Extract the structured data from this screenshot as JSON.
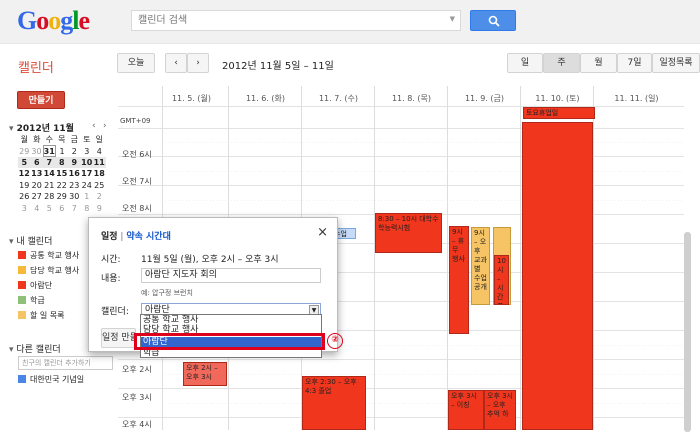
{
  "header": {
    "logo": "Google",
    "search_placeholder": "캘린더 검색"
  },
  "toolbar": {
    "app_title": "캘린더",
    "today": "오늘",
    "prev": "‹",
    "next": "›",
    "date_range": "2012년 11월 5일 – 11일",
    "views": {
      "day": "일",
      "week": "주",
      "month": "월",
      "seven_day": "7일",
      "schedule": "일정목록"
    }
  },
  "sidebar": {
    "create": "만들기",
    "mini_calendar": {
      "title": "2012년 11월",
      "weekdays": [
        "월",
        "화",
        "수",
        "목",
        "금",
        "토",
        "일"
      ],
      "rows": [
        [
          "29",
          "30",
          "31",
          "1",
          "2",
          "3",
          "4"
        ],
        [
          "5",
          "6",
          "7",
          "8",
          "9",
          "10",
          "11"
        ],
        [
          "12",
          "13",
          "14",
          "15",
          "16",
          "17",
          "18"
        ],
        [
          "19",
          "20",
          "21",
          "22",
          "23",
          "24",
          "25"
        ],
        [
          "26",
          "27",
          "28",
          "29",
          "30",
          "1",
          "2"
        ],
        [
          "3",
          "4",
          "5",
          "6",
          "7",
          "8",
          "9"
        ]
      ]
    },
    "my_calendars_title": "내 캘린더",
    "my_calendars": [
      {
        "label": "공통 학교 행사",
        "color": "#f1361e"
      },
      {
        "label": "담당 학교 행사",
        "color": "#f6b93b"
      },
      {
        "label": "아람단",
        "color": "#f1361e"
      },
      {
        "label": "학급",
        "color": "#8ec07a"
      },
      {
        "label": "할 일 목록",
        "color": "#f6c365"
      }
    ],
    "other_calendars_title": "다른 캘린더",
    "friend_input_placeholder": "친구의 캘린더 추가하기",
    "other_calendars": [
      {
        "label": "대한민국 기념일",
        "color": "#4a86e8"
      }
    ]
  },
  "grid": {
    "timezone": "GMT+09",
    "days": [
      "11. 5. (월)",
      "11. 6. (화)",
      "11. 7. (수)",
      "11. 8. (목)",
      "11. 9. (금)",
      "11. 10. (토)",
      "11. 11. (일)"
    ],
    "times": [
      "오전 6시",
      "오전 7시",
      "오전 8시",
      "오후 2시",
      "오후 3시",
      "오후 4시"
    ],
    "events": {
      "allday_sat": "토요휴업일",
      "wed_morning": "수업",
      "thu_morning": "8:30 – 10시 대학수학능력시험",
      "fri_a": "9시 – 휴무 행사",
      "fri_b": "9시 – 오후 교과별 수업공개",
      "fri_c": "10시 – 시간표 운영",
      "mon_pm": "오후 2시 – 오후 3시",
      "wed_pm": "오후 2:30 – 오후 4:3 졸업",
      "fri_pm_a": "오후 3시 – 이칭",
      "fri_pm_b": "오후 3시 – 오후 추억 하"
    }
  },
  "popup": {
    "title_prefix": "일정",
    "title_sep": " | ",
    "title_link": "약속 시간대",
    "close": "×",
    "time_label": "시간:",
    "time_value": "11월 5일 (월), 오후 2시 – 오후 3시",
    "content_label": "내용:",
    "content_value": "아람단 지도자 회의",
    "example": "예: 압구정 브런치",
    "calendar_label": "캘린더:",
    "calendar_value": "아람단",
    "edit_button": "일정 만들기"
  },
  "dropdown": {
    "options": [
      "공통 학교 행사",
      "담당 학교 행사",
      "아람단",
      "학급"
    ],
    "selected_index": 2
  },
  "annotation": {
    "step": "②"
  }
}
